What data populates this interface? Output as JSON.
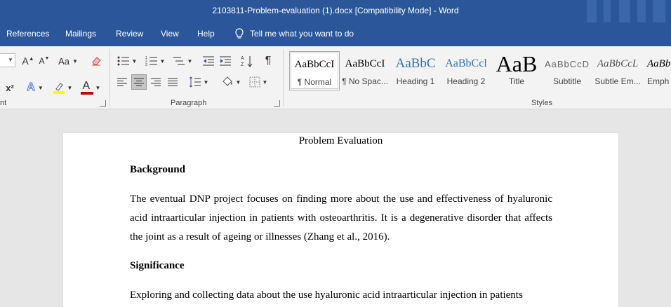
{
  "window": {
    "title": "2103811-Problem-evaluation (1).docx [Compatibility Mode]  -  Word"
  },
  "ribbon_tabs": [
    "References",
    "Mailings",
    "Review",
    "View",
    "Help"
  ],
  "tell_me": "Tell me what you want to do",
  "ribbon": {
    "group_font_label": "nt",
    "group_paragraph_label": "Paragraph",
    "group_styles_label": "Styles",
    "grow_font_glyph": "A",
    "shrink_font_glyph": "A",
    "change_case_glyph": "Aa",
    "superscript_glyph": "x²",
    "font_color_glyph": "A",
    "text_effects_glyph": "A",
    "pilcrow_glyph": "¶",
    "colors": {
      "highlight": "#ffff00",
      "font_color": "#c00000",
      "effects": "#4472c4"
    }
  },
  "styles": [
    {
      "sample": "AaBbCcI",
      "name": "¶ Normal",
      "active": true
    },
    {
      "sample": "AaBbCcI",
      "name": "¶ No Spac..."
    },
    {
      "sample": "AaBbC",
      "name": "Heading 1"
    },
    {
      "sample": "AaBbCcl",
      "name": "Heading 2"
    },
    {
      "sample": "AaB",
      "name": "Title"
    },
    {
      "sample": "AaBbCcD",
      "name": "Subtitle"
    },
    {
      "sample": "AaBbCcL",
      "name": "Subtle Em..."
    },
    {
      "sample": "AaBb",
      "name": "Emph"
    }
  ],
  "document": {
    "title": "Problem Evaluation",
    "heading_background": "Background",
    "para_background": "The eventual DNP project focuses on finding more about the use and effectiveness of hyaluronic acid intraarticular injection in patients with osteoarthritis. It is a degenerative disorder that affects the joint as a result of ageing or illnesses (Zhang et al., 2016).",
    "heading_significance": "Significance",
    "para_significance": "Exploring and collecting data about the use hyaluronic acid intraarticular injection in patients"
  }
}
